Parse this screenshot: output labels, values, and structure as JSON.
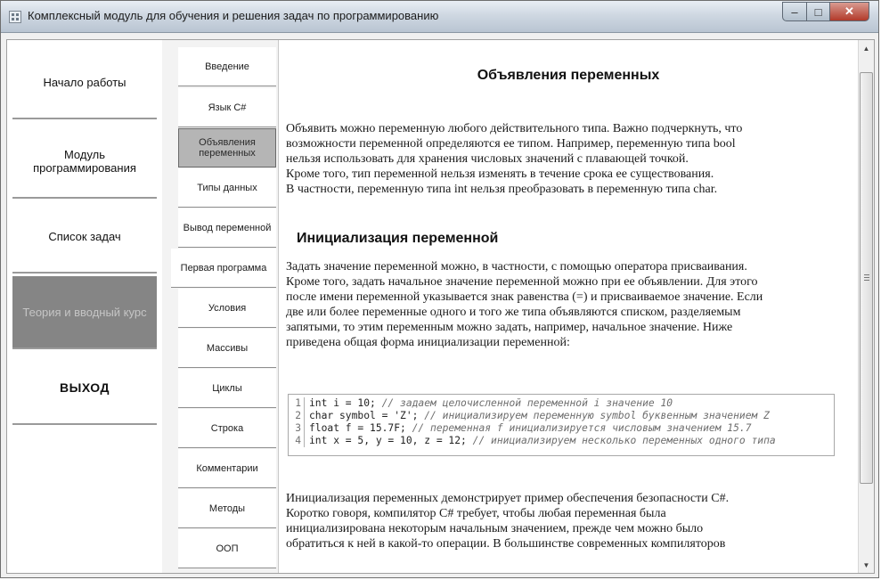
{
  "window": {
    "title": "Комплексный модуль для обучения и решения задач по программированию",
    "controls": {
      "minimize": "–",
      "maximize": "□",
      "close": "✕"
    }
  },
  "nav": [
    {
      "label": "Начало работы"
    },
    {
      "label": "Модуль программирования"
    },
    {
      "label": "Список задач"
    },
    {
      "label": "Теория и вводный курс"
    },
    {
      "label": "ВЫХОД"
    }
  ],
  "topics": [
    {
      "label": "Введение"
    },
    {
      "label": "Язык C#"
    },
    {
      "label": "Объявления переменных"
    },
    {
      "label": "Типы данных"
    },
    {
      "label": "Вывод переменной"
    },
    {
      "label": "Первая программа"
    },
    {
      "label": "Условия"
    },
    {
      "label": "Массивы"
    },
    {
      "label": "Циклы"
    },
    {
      "label": "Строка"
    },
    {
      "label": "Комментарии"
    },
    {
      "label": "Методы"
    },
    {
      "label": "ООП"
    }
  ],
  "content": {
    "heading": "Объявления переменных",
    "paragraph1": [
      "Объявить можно переменную любого действительного типа. Важно подчеркнуть, что",
      "возможности переменной определяются ее типом. Например, переменную типа bool",
      "нельзя использовать для хранения числовых значений с плавающей точкой.",
      "Кроме того, тип переменной нельзя изменять в течение срока ее существования.",
      "В частности, переменную типа int нельзя преобразовать в переменную типа char."
    ],
    "subheading": "Инициализация переменной",
    "paragraph2": [
      "Задать значение переменной можно, в частности, с помощью оператора присваивания.",
      "Кроме того, задать начальное значение переменной можно при ее объявлении. Для этого",
      "после имени переменной указывается знак равенства (=) и присваиваемое значение. Если",
      "две или более переменные одного и того же типа объявляются списком, разделяемым",
      "запятыми, то этим переменным можно задать, например, начальное значение. Ниже",
      "приведена общая форма инициализации переменной:"
    ],
    "code": [
      {
        "n": "1",
        "code": "int i = 10; ",
        "comment": "// задаем целочисленной переменной i значение 10"
      },
      {
        "n": "2",
        "code": "char symbol = 'Z'; ",
        "comment": "// инициализируем переменную symbol буквенным значением Z"
      },
      {
        "n": "3",
        "code": "float f = 15.7F; ",
        "comment": "// переменная f инициализируется числовым значением 15.7"
      },
      {
        "n": "4",
        "code": "int x = 5, y = 10, z = 12; ",
        "comment": "// инициализируем несколько переменных одного типа"
      }
    ],
    "paragraph3": [
      "Инициализация переменных демонстрирует пример обеспечения безопасности C#.",
      "Коротко говоря, компилятор C# требует, чтобы любая переменная была",
      "инициализирована некоторым начальным значением, прежде чем можно было",
      "обратиться к ней в какой-то операции. В большинстве современных компиляторов"
    ]
  },
  "scrollbar": {
    "up": "▲",
    "down": "▼"
  }
}
